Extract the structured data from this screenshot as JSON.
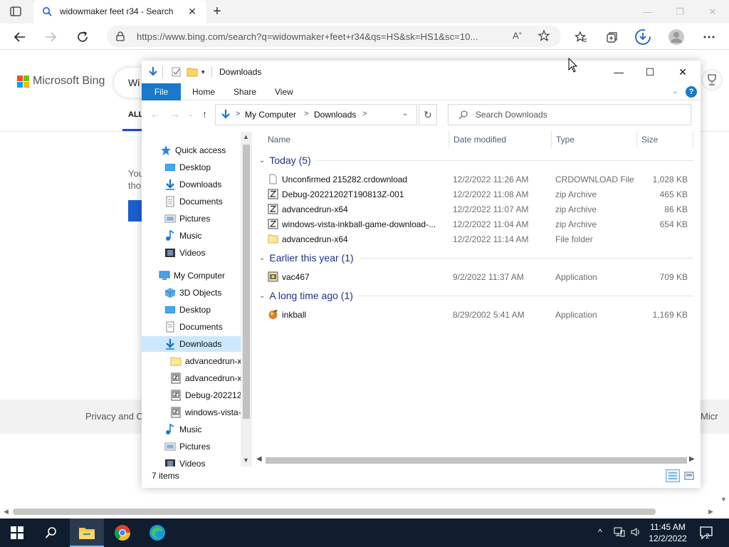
{
  "browser": {
    "tab_title": "widowmaker feet r34 - Search",
    "url": "https://www.bing.com/search?q=widowmaker+feet+r34&qs=HS&sk=HS1&sc=10...",
    "icons": [
      "tab-actions-icon",
      "bing-search-icon",
      "close-icon",
      "new-tab-icon",
      "back-icon",
      "forward-icon",
      "refresh-icon",
      "lock-icon",
      "read-aloud-icon",
      "add-favorite-icon",
      "favorites-icon",
      "collections-icon",
      "downloads-icon",
      "profile-icon",
      "more-icon"
    ]
  },
  "bing": {
    "brand": "Microsoft Bing",
    "search_stub": "Wi",
    "all_tab": "ALL",
    "snippet_line1": "You",
    "snippet_line2": "tho",
    "footer_privacy": "Privacy and C",
    "footer_right": "Micr",
    "colors": {
      "ms_red": "#f25022",
      "ms_green": "#7fba00",
      "ms_blue": "#00a4ef",
      "ms_yellow": "#ffb900",
      "accent": "#174ae4"
    }
  },
  "explorer": {
    "title": "Downloads",
    "ribbon": {
      "file": "File",
      "home": "Home",
      "share": "Share",
      "view": "View",
      "help": "?"
    },
    "address": {
      "crumb1": "My Computer",
      "crumb2": "Downloads",
      "sep": ">"
    },
    "search_placeholder": "Search Downloads",
    "nav": {
      "quick_access": "Quick access",
      "qa_desktop": "Desktop",
      "qa_downloads": "Downloads",
      "qa_documents": "Documents",
      "qa_pictures": "Pictures",
      "qa_music": "Music",
      "qa_videos": "Videos",
      "my_computer": "My Computer",
      "mc_3d": "3D Objects",
      "mc_desktop": "Desktop",
      "mc_documents": "Documents",
      "mc_downloads": "Downloads",
      "dl_sub1": "advancedrun-x",
      "dl_sub2": "advancedrun-x",
      "dl_sub3": "Debug-2022120",
      "dl_sub4": "windows-vista-",
      "mc_music": "Music",
      "mc_pictures": "Pictures",
      "mc_videos": "Videos"
    },
    "columns": {
      "name": "Name",
      "date": "Date modified",
      "type": "Type",
      "size": "Size"
    },
    "groups": {
      "today": {
        "label": "Today (5)",
        "files": [
          {
            "name": "Unconfirmed 215282.crdownload",
            "date": "12/2/2022 11:26 AM",
            "type": "CRDOWNLOAD File",
            "size": "1,028 KB",
            "icon": "blank-file-icon"
          },
          {
            "name": "Debug-20221202T190813Z-001",
            "date": "12/2/2022 11:08 AM",
            "type": "zip Archive",
            "size": "465 KB",
            "icon": "zip-icon"
          },
          {
            "name": "advancedrun-x64",
            "date": "12/2/2022 11:07 AM",
            "type": "zip Archive",
            "size": "86 KB",
            "icon": "zip-icon"
          },
          {
            "name": "windows-vista-inkball-game-download-...",
            "date": "12/2/2022 11:04 AM",
            "type": "zip Archive",
            "size": "654 KB",
            "icon": "zip-icon"
          },
          {
            "name": "advancedrun-x64",
            "date": "12/2/2022 11:14 AM",
            "type": "File folder",
            "size": "",
            "icon": "folder-icon"
          }
        ]
      },
      "earlier": {
        "label": "Earlier this year (1)",
        "files": [
          {
            "name": "vac467",
            "date": "9/2/2022 11:37 AM",
            "type": "Application",
            "size": "709 KB",
            "icon": "app-icon"
          }
        ]
      },
      "long_ago": {
        "label": "A long time ago (1)",
        "files": [
          {
            "name": "inkball",
            "date": "8/29/2002 5:41 AM",
            "type": "Application",
            "size": "1,169 KB",
            "icon": "inkball-icon"
          }
        ]
      }
    },
    "status": "7 items"
  },
  "taskbar": {
    "time": "11:45 AM",
    "date": "12/2/2022",
    "notifications": "2",
    "items": [
      "start-icon",
      "search-icon",
      "file-explorer-icon",
      "chrome-icon",
      "edge-icon"
    ]
  }
}
